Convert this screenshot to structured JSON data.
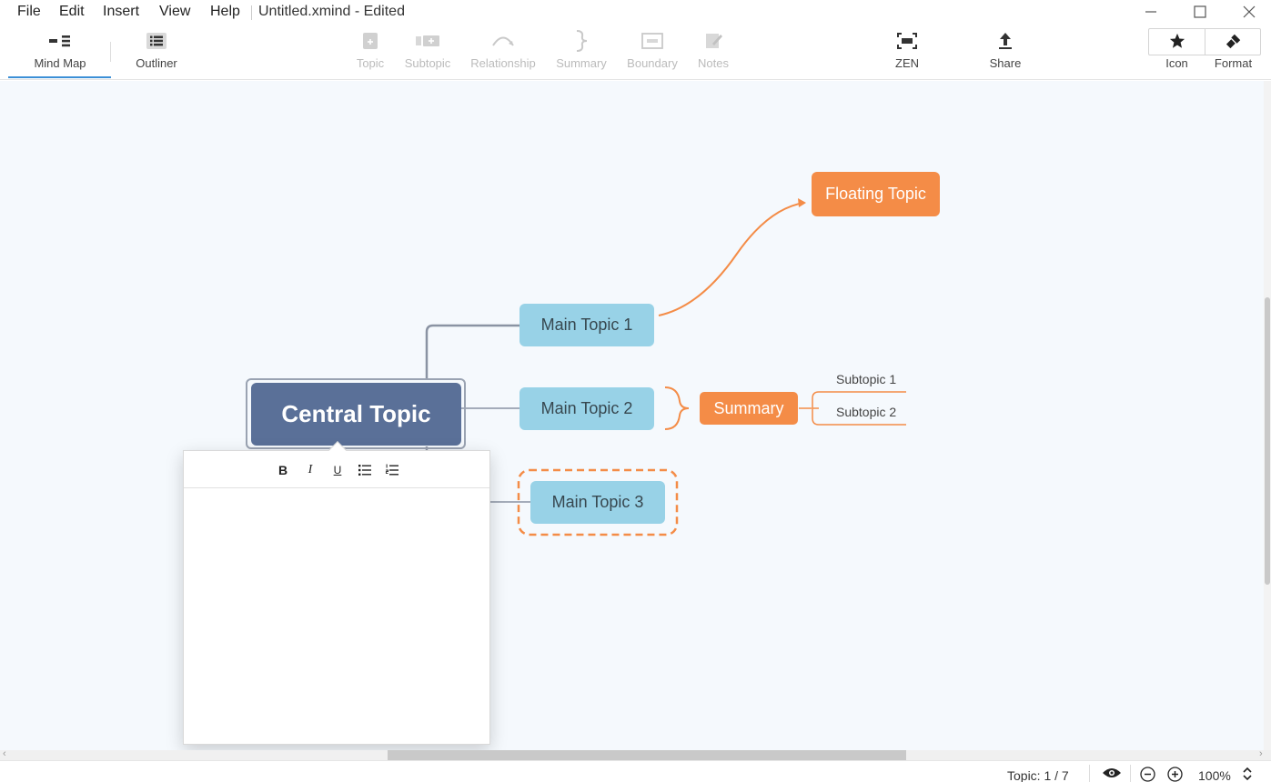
{
  "menu": {
    "items": [
      "File",
      "Edit",
      "Insert",
      "View",
      "Help"
    ],
    "doc_title": "Untitled.xmind - Edited"
  },
  "window_controls": {
    "minimize": "—",
    "maximize": "☐",
    "close": "✕"
  },
  "toolbar": {
    "views": [
      {
        "label": "Mind Map",
        "icon": "mind-map-icon",
        "active": true
      },
      {
        "label": "Outliner",
        "icon": "outliner-icon",
        "active": false
      }
    ],
    "insert_tools": [
      {
        "label": "Topic",
        "icon": "topic-icon",
        "enabled": false
      },
      {
        "label": "Subtopic",
        "icon": "subtopic-icon",
        "enabled": false
      },
      {
        "label": "Relationship",
        "icon": "relationship-icon",
        "enabled": false
      },
      {
        "label": "Summary",
        "icon": "summary-icon",
        "enabled": false
      },
      {
        "label": "Boundary",
        "icon": "boundary-icon",
        "enabled": false
      },
      {
        "label": "Notes",
        "icon": "notes-icon",
        "enabled": false
      }
    ],
    "zen_label": "ZEN",
    "share_label": "Share",
    "icon_label": "Icon",
    "format_label": "Format"
  },
  "mindmap": {
    "central_topic": "Central Topic",
    "main_topics": [
      "Main Topic 1",
      "Main Topic 2",
      "Main Topic 3"
    ],
    "floating_topic": "Floating Topic",
    "summary": "Summary",
    "subtopics": [
      "Subtopic 1",
      "Subtopic 2"
    ],
    "colors": {
      "central": "#5a7098",
      "main": "#98d2e7",
      "accent": "#f48c47",
      "canvas": "#f5f9fd"
    }
  },
  "notes_editor": {
    "buttons": [
      {
        "label": "B",
        "icon": "bold-icon"
      },
      {
        "label": "I",
        "icon": "italic-icon"
      },
      {
        "label": "U",
        "icon": "underline-icon"
      },
      {
        "label": "",
        "icon": "bullet-list-icon"
      },
      {
        "label": "",
        "icon": "numbered-list-icon"
      }
    ],
    "content": ""
  },
  "status": {
    "topic_count": "Topic: 1 / 7",
    "zoom": "100%"
  }
}
